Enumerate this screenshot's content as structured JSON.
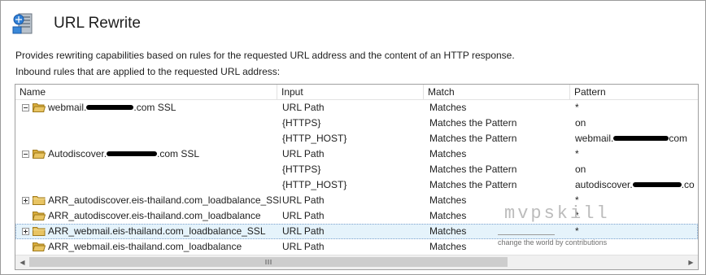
{
  "header": {
    "title": "URL Rewrite",
    "icon": "url-rewrite-icon"
  },
  "description": "Provides rewriting capabilities based on rules for the requested URL address and the content of an HTTP response.",
  "subheading": "Inbound rules that are applied to the requested URL address:",
  "columns": {
    "name": "Name",
    "input": "Input",
    "match": "Match",
    "pattern": "Pattern"
  },
  "rows": [
    {
      "expander": "minus",
      "icon": "folder-open-icon",
      "name_prefix": "webmail.",
      "name_suffix": ".com SSL",
      "input": "URL Path",
      "match": "Matches",
      "pattern_prefix": "*",
      "pattern_suffix": ""
    },
    {
      "expander": "",
      "icon": "",
      "name_prefix": "",
      "name_suffix": "",
      "input": "{HTTPS}",
      "match": "Matches the Pattern",
      "pattern_prefix": "on",
      "pattern_suffix": ""
    },
    {
      "expander": "",
      "icon": "",
      "name_prefix": "",
      "name_suffix": "",
      "input": "{HTTP_HOST}",
      "match": "Matches the Pattern",
      "pattern_prefix": "webmail.",
      "pattern_suffix": "com"
    },
    {
      "expander": "minus",
      "icon": "folder-open-icon",
      "name_prefix": "Autodiscover.",
      "name_suffix": ".com SSL",
      "input": "URL Path",
      "match": "Matches",
      "pattern_prefix": "*",
      "pattern_suffix": ""
    },
    {
      "expander": "",
      "icon": "",
      "name_prefix": "",
      "name_suffix": "",
      "input": "{HTTPS}",
      "match": "Matches the Pattern",
      "pattern_prefix": "on",
      "pattern_suffix": ""
    },
    {
      "expander": "",
      "icon": "",
      "name_prefix": "",
      "name_suffix": "",
      "input": "{HTTP_HOST}",
      "match": "Matches the Pattern",
      "pattern_prefix": "autodiscover.",
      "pattern_suffix": ".co"
    },
    {
      "expander": "plus",
      "icon": "folder-closed-icon",
      "name_prefix": "ARR_autodiscover.eis-thailand.com_loadbalance_SSL",
      "name_suffix": "",
      "input": "URL Path",
      "match": "Matches",
      "pattern_prefix": "*",
      "pattern_suffix": ""
    },
    {
      "expander": "",
      "icon": "folder-open-icon",
      "name_prefix": "ARR_autodiscover.eis-thailand.com_loadbalance",
      "name_suffix": "",
      "input": "URL Path",
      "match": "Matches",
      "pattern_prefix": "*",
      "pattern_suffix": ""
    },
    {
      "expander": "plus",
      "icon": "folder-closed-icon",
      "name_prefix": "ARR_webmail.eis-thailand.com_loadbalance_SSL",
      "name_suffix": "",
      "input": "URL Path",
      "match": "Matches",
      "pattern_prefix": "*",
      "pattern_suffix": "",
      "selected": true
    },
    {
      "expander": "",
      "icon": "folder-open-icon",
      "name_prefix": "ARR_webmail.eis-thailand.com_loadbalance",
      "name_suffix": "",
      "input": "URL Path",
      "match": "Matches",
      "pattern_prefix": "",
      "pattern_suffix": ""
    }
  ],
  "watermark": {
    "logo": "mvpskill",
    "tagline": "change the world by contributions"
  },
  "colors": {
    "selection": "#e5f3fb",
    "folder": "#e8c463",
    "border": "#a0a0a0"
  }
}
